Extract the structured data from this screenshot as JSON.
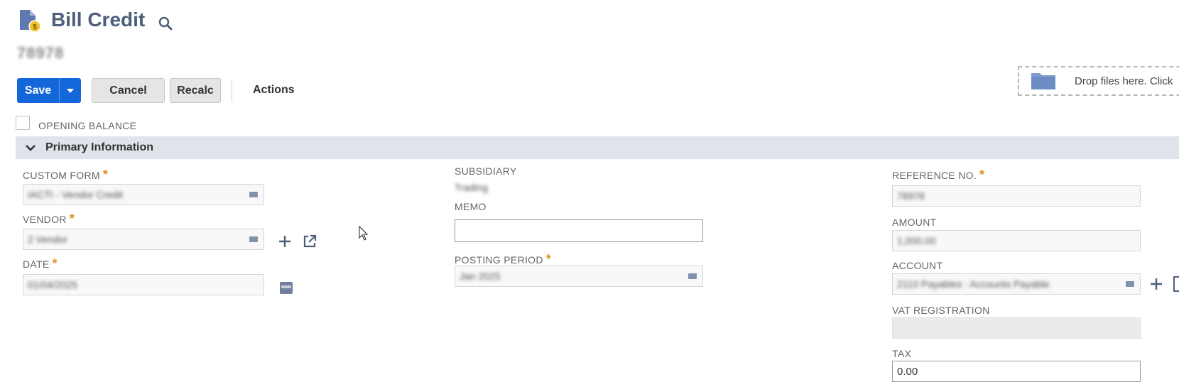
{
  "header": {
    "title": "Bill Credit",
    "record_id": "78978"
  },
  "toolbar": {
    "save_label": "Save",
    "cancel_label": "Cancel",
    "recalc_label": "Recalc",
    "actions_label": "Actions"
  },
  "dropzone": {
    "text": "Drop files here. Click"
  },
  "opening_balance": {
    "label": "OPENING BALANCE",
    "checked": false
  },
  "section": {
    "title": "Primary Information"
  },
  "fields": {
    "custom_form": {
      "label": "CUSTOM FORM",
      "value": "IACTI - Vendor Credit"
    },
    "vendor": {
      "label": "VENDOR",
      "value": "2 Vendor"
    },
    "date": {
      "label": "DATE",
      "value": "01/04/2025"
    },
    "subsidiary": {
      "label": "SUBSIDIARY",
      "value": "Trading"
    },
    "memo": {
      "label": "MEMO",
      "value": ""
    },
    "posting_period": {
      "label": "POSTING PERIOD",
      "value": "Jan 2025"
    },
    "reference_no": {
      "label": "REFERENCE NO.",
      "value": "78978"
    },
    "amount": {
      "label": "AMOUNT",
      "value": "1,000.00"
    },
    "account": {
      "label": "ACCOUNT",
      "value": "2110 Payables : Accounts Payable"
    },
    "vat_registration": {
      "label": "VAT REGISTRATION",
      "value": ""
    },
    "tax": {
      "label": "TAX",
      "value": "0.00"
    }
  },
  "required_marker": "*",
  "colors": {
    "primary_button": "#1467d8",
    "section_bar": "#dfe4eb",
    "title": "#4d5f79",
    "required": "#e0902a"
  }
}
